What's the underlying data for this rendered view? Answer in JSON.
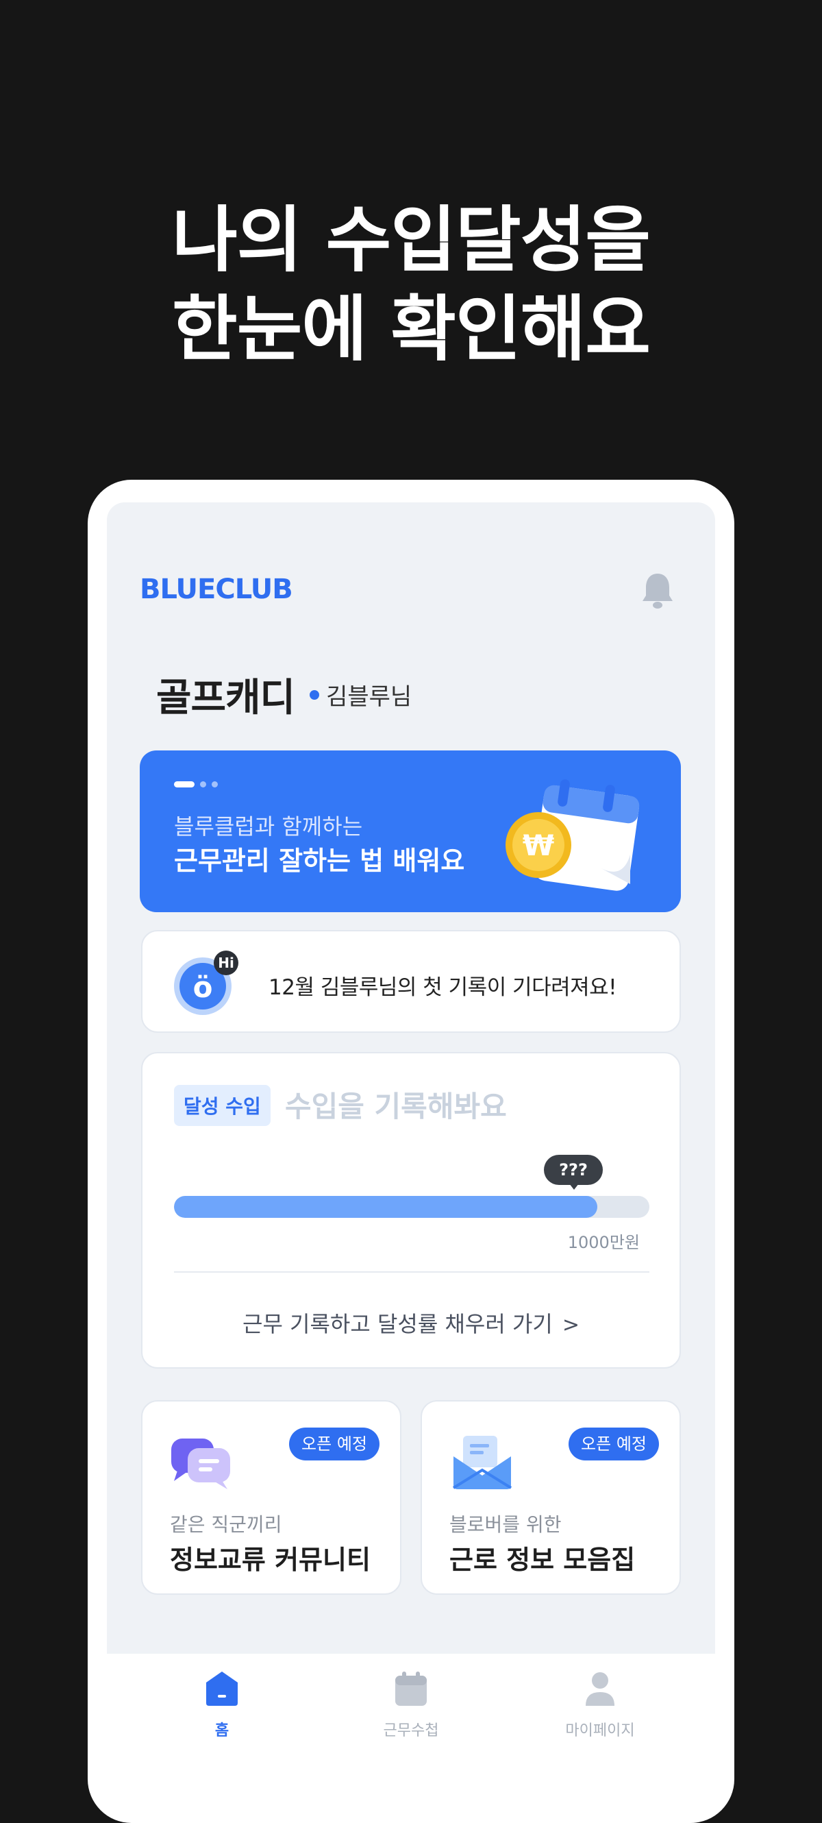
{
  "headline": {
    "line1": "나의 수입달성을",
    "line2": "한눈에 확인해요"
  },
  "app": {
    "logo": "BLUECLUB",
    "brand_color": "#2f6ef0"
  },
  "profile": {
    "job": "골프캐디",
    "name": "김블루님"
  },
  "banner": {
    "subtitle": "블루클럽과 함께하는",
    "title": "근무관리 잘하는 법 배워요",
    "page_count": 3,
    "active_page": 1,
    "icon": "calendar-coin-illustration"
  },
  "greeting": {
    "avatar_badge": "Hi",
    "avatar_letter": "ö",
    "message": "12월 김블루님의 첫 기록이 기다려져요!"
  },
  "income": {
    "tag": "달성 수입",
    "placeholder": "수입을 기록해봐요",
    "tooltip": "???",
    "progress_fraction": 0.89,
    "goal": "1000만원",
    "cta": "근무 기록하고 달성률 채우러 가기"
  },
  "features": [
    {
      "badge": "오픈 예정",
      "subtitle": "같은 직군끼리",
      "title": "정보교류 커뮤니티",
      "icon": "chat-bubbles-icon"
    },
    {
      "badge": "오픈 예정",
      "subtitle": "블로버를 위한",
      "title": "근로 정보 모음집",
      "icon": "mail-envelope-icon"
    }
  ],
  "tabs": [
    {
      "label": "홈",
      "icon": "home-icon",
      "active": true
    },
    {
      "label": "근무수첩",
      "icon": "calendar-icon",
      "active": false
    },
    {
      "label": "마이페이지",
      "icon": "person-icon",
      "active": false
    }
  ]
}
